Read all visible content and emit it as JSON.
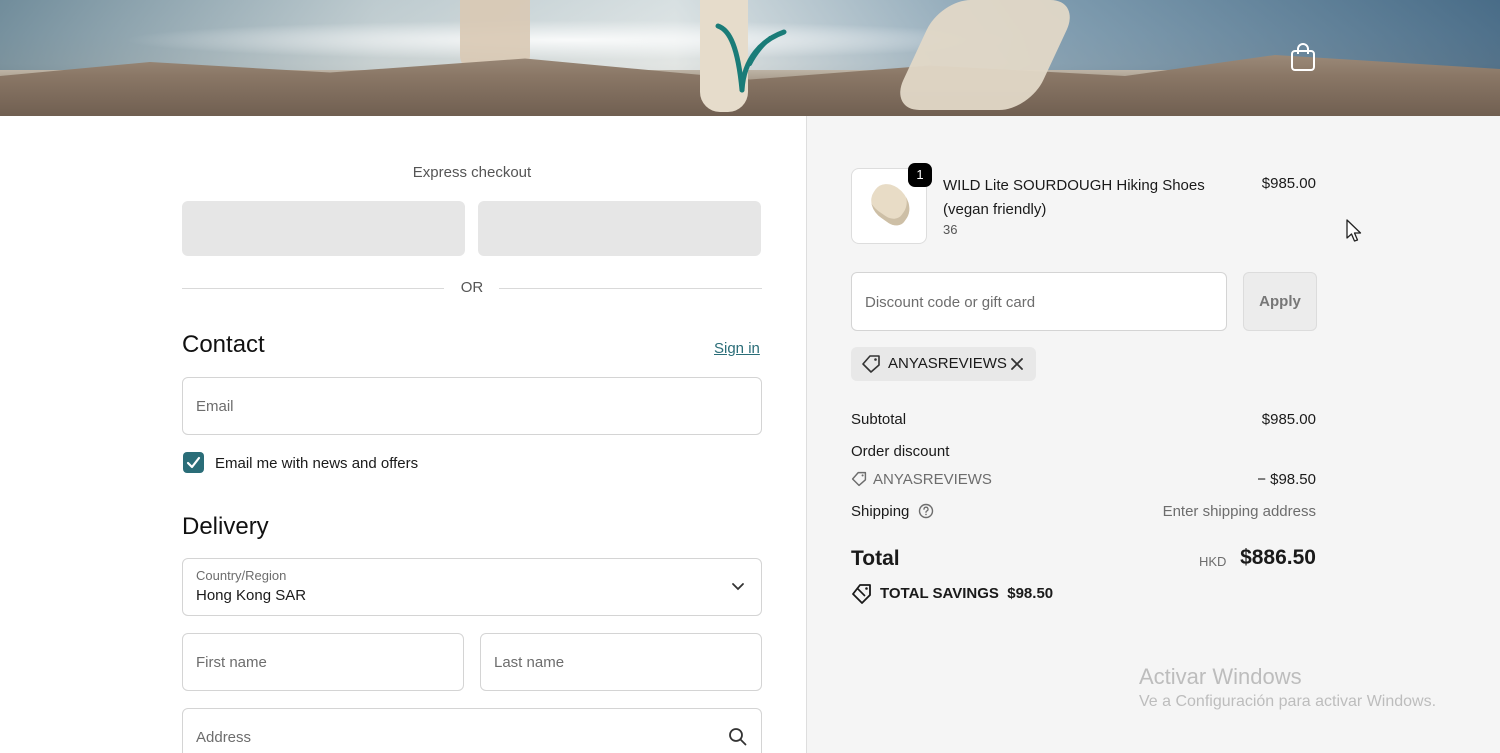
{
  "header": {
    "logo": "brand-logo",
    "cart_icon": "shopping-bag-icon"
  },
  "express": {
    "title": "Express checkout",
    "or": "OR"
  },
  "contact": {
    "heading": "Contact",
    "sign_in": "Sign in",
    "email_placeholder": "Email",
    "newsletter_label": "Email me with news and offers",
    "newsletter_checked": true
  },
  "delivery": {
    "heading": "Delivery",
    "country_label": "Country/Region",
    "country_value": "Hong Kong SAR",
    "first_name_placeholder": "First name",
    "last_name_placeholder": "Last name",
    "address_placeholder": "Address"
  },
  "summary": {
    "item": {
      "name": "WILD Lite SOURDOUGH Hiking Shoes (vegan friendly)",
      "variant": "36",
      "quantity": "1",
      "price": "$985.00"
    },
    "discount_placeholder": "Discount code or gift card",
    "apply": "Apply",
    "applied_code": "ANYASREVIEWS",
    "subtotal_label": "Subtotal",
    "subtotal_value": "$985.00",
    "order_discount_label": "Order discount",
    "discount_code": "ANYASREVIEWS",
    "discount_value": "− $98.50",
    "shipping_label": "Shipping",
    "shipping_value": "Enter shipping address",
    "total_label": "Total",
    "total_currency": "HKD",
    "total_value": "$886.50",
    "savings_label": "TOTAL SAVINGS",
    "savings_value": "$98.50"
  },
  "watermark": {
    "title": "Activar Windows",
    "subtitle": "Ve a Configuración para activar Windows."
  },
  "colors": {
    "accent": "#2a6d78",
    "summary_bg": "#f5f5f5"
  }
}
